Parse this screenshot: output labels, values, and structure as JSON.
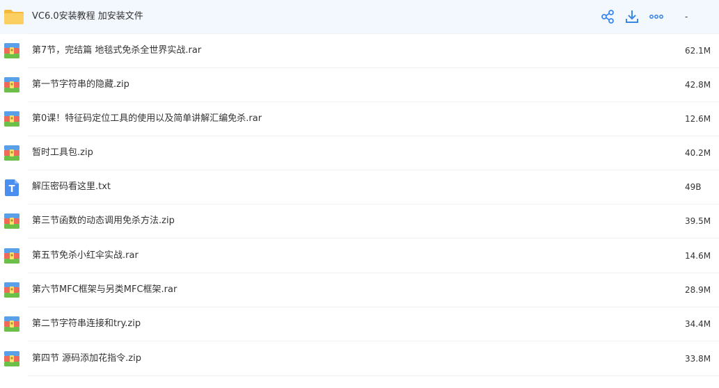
{
  "colors": {
    "accent": "#3b87e8",
    "hover_row_bg": "#f3f7fe",
    "folder": "#f9c65a",
    "txt_icon": "#4a8ef0"
  },
  "rows": [
    {
      "name": "VC6.0安装教程 加安装文件",
      "size": "-",
      "type": "folder",
      "icon": "folder-icon",
      "hovered": true
    },
    {
      "name": "第7节，完结篇 地毯式免杀全世界实战.rar",
      "size": "62.1M",
      "type": "archive",
      "icon": "archive-icon"
    },
    {
      "name": "第一节字符串的隐藏.zip",
      "size": "42.8M",
      "type": "archive",
      "icon": "archive-icon"
    },
    {
      "name": "第0课！特征码定位工具的使用以及简单讲解汇编免杀.rar",
      "size": "12.6M",
      "type": "archive",
      "icon": "archive-icon"
    },
    {
      "name": "暂时工具包.zip",
      "size": "40.2M",
      "type": "archive",
      "icon": "archive-icon"
    },
    {
      "name": "解压密码看这里.txt",
      "size": "49B",
      "type": "text",
      "icon": "text-file-icon"
    },
    {
      "name": "第三节函数的动态调用免杀方法.zip",
      "size": "39.5M",
      "type": "archive",
      "icon": "archive-icon"
    },
    {
      "name": "第五节免杀小红伞实战.rar",
      "size": "14.6M",
      "type": "archive",
      "icon": "archive-icon"
    },
    {
      "name": "第六节MFC框架与另类MFC框架.rar",
      "size": "28.9M",
      "type": "archive",
      "icon": "archive-icon"
    },
    {
      "name": "第二节字符串连接和try.zip",
      "size": "34.4M",
      "type": "archive",
      "icon": "archive-icon"
    },
    {
      "name": "第四节 源码添加花指令.zip",
      "size": "33.8M",
      "type": "archive",
      "icon": "archive-icon"
    }
  ],
  "row_actions": {
    "share_icon": "share-icon",
    "download_icon": "download-icon",
    "more_icon": "more-icon"
  }
}
